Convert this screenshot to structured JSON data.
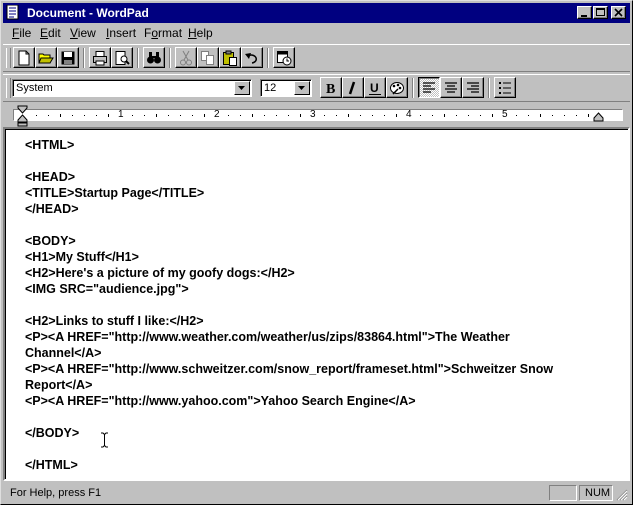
{
  "window": {
    "title": "Document - WordPad"
  },
  "menu": {
    "items": [
      {
        "key": "F",
        "rest": "ile"
      },
      {
        "key": "E",
        "rest": "dit"
      },
      {
        "key": "V",
        "rest": "iew"
      },
      {
        "key": "I",
        "rest": "nsert"
      },
      {
        "key": "",
        "pre": "F",
        "key2": "o",
        "rest": "rmat"
      },
      {
        "key": "H",
        "rest": "elp"
      }
    ]
  },
  "format_bar": {
    "font": "System",
    "size": "12"
  },
  "ruler": {
    "numbers": [
      "1",
      "2",
      "3",
      "4",
      "5"
    ]
  },
  "document": {
    "lines": [
      "<HTML>",
      "",
      "<HEAD>",
      "<TITLE>Startup Page</TITLE>",
      "</HEAD>",
      "",
      "<BODY>",
      "<H1>My Stuff</H1>",
      "<H2>Here's a picture of my goofy dogs:</H2>",
      "<IMG SRC=\"audience.jpg\">",
      "",
      "<H2>Links to stuff I like:</H2>",
      "<P><A HREF=\"http://www.weather.com/weather/us/zips/83864.html\">The Weather",
      "Channel</A>",
      "<P><A HREF=\"http://www.schweitzer.com/snow_report/frameset.html\">Schweitzer Snow",
      "Report</A>",
      "<P><A HREF=\"http://www.yahoo.com\">Yahoo Search Engine</A>",
      "",
      "</BODY>",
      "",
      "</HTML>"
    ]
  },
  "status": {
    "help_text": "For Help, press F1",
    "num": "NUM"
  },
  "colors": {
    "titlebar": "#000080",
    "face": "#c0c0c0"
  }
}
